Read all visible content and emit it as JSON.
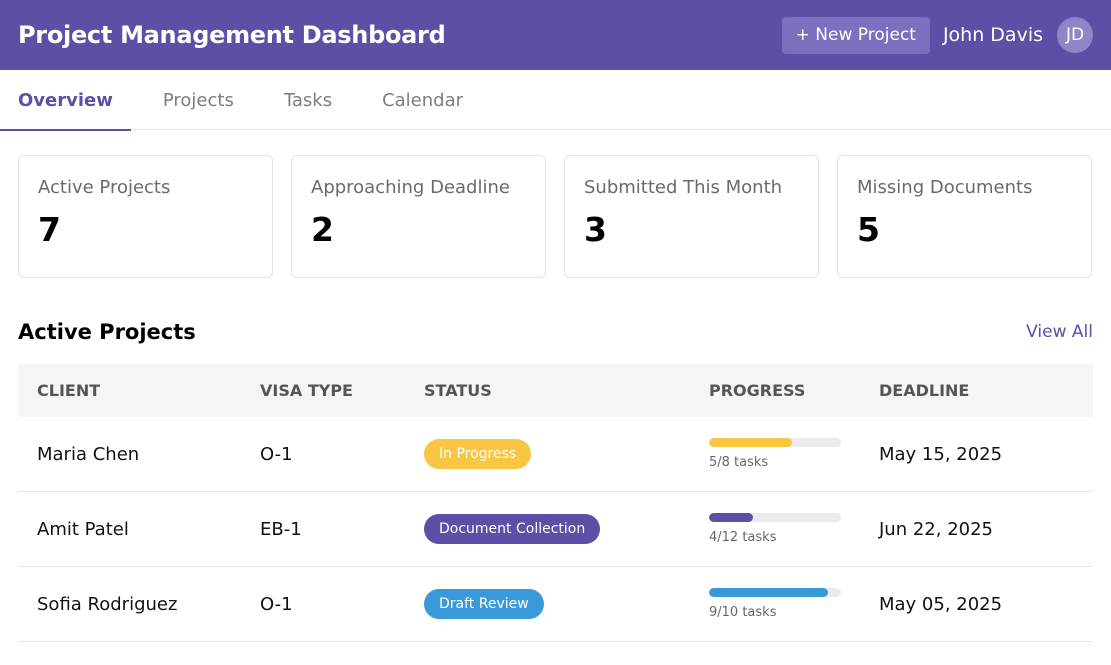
{
  "header": {
    "title": "Project Management Dashboard",
    "new_project_label": "+ New Project",
    "user_name": "John Davis",
    "user_initials": "JD"
  },
  "tabs": [
    {
      "label": "Overview",
      "active": true
    },
    {
      "label": "Projects",
      "active": false
    },
    {
      "label": "Tasks",
      "active": false
    },
    {
      "label": "Calendar",
      "active": false
    }
  ],
  "stats": [
    {
      "label": "Active Projects",
      "value": "7"
    },
    {
      "label": "Approaching Deadline",
      "value": "2"
    },
    {
      "label": "Submitted This Month",
      "value": "3"
    },
    {
      "label": "Missing Documents",
      "value": "5"
    }
  ],
  "projects_section": {
    "title": "Active Projects",
    "view_all_label": "View All",
    "columns": [
      "CLIENT",
      "VISA TYPE",
      "STATUS",
      "PROGRESS",
      "DEADLINE"
    ],
    "rows": [
      {
        "client": "Maria Chen",
        "visa_type": "O-1",
        "status": "In Progress",
        "status_color": "#f7c744",
        "progress_fraction": 0.625,
        "progress_color": "#f7c744",
        "progress_text": "5/8 tasks",
        "deadline": "May 15, 2025"
      },
      {
        "client": "Amit Patel",
        "visa_type": "EB-1",
        "status": "Document Collection",
        "status_color": "#5b4fa6",
        "progress_fraction": 0.333,
        "progress_color": "#5b4fa6",
        "progress_text": "4/12 tasks",
        "deadline": "Jun 22, 2025"
      },
      {
        "client": "Sofia Rodriguez",
        "visa_type": "O-1",
        "status": "Draft Review",
        "status_color": "#3a9ad9",
        "progress_fraction": 0.9,
        "progress_color": "#3a9ad9",
        "progress_text": "9/10 tasks",
        "deadline": "May 05, 2025"
      }
    ]
  },
  "colors": {
    "brand": "#5b4fa6",
    "button_bg": "#7a70bd",
    "avatar_bg": "#8e86c8"
  }
}
